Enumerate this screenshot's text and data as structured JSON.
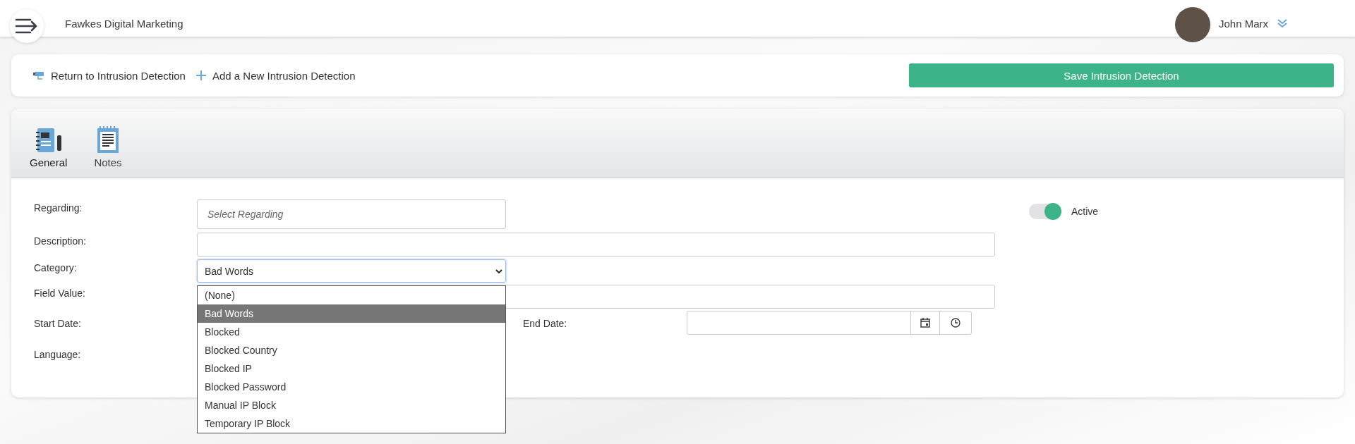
{
  "header": {
    "company": "Fawkes Digital Marketing",
    "user": "John Marx"
  },
  "toolbar": {
    "links": [
      "Return to Intrusion Detection",
      "Add a New Intrusion Detection"
    ],
    "save_button": "Save Intrusion Detection"
  },
  "tabs": [
    {
      "label": "General",
      "selected": true
    },
    {
      "label": "Notes",
      "selected": false
    }
  ],
  "form": {
    "regarding": {
      "label": "Regarding:",
      "placeholder": "Select Regarding"
    },
    "description": {
      "label": "Description:"
    },
    "category": {
      "label": "Category:",
      "value": "Bad Words",
      "expanded": true,
      "options": [
        {
          "label": "(None)",
          "selected": false
        },
        {
          "label": "Bad Words",
          "selected": true
        },
        {
          "label": "Blocked",
          "selected": false
        },
        {
          "label": "Blocked Country",
          "selected": false
        },
        {
          "label": "Blocked IP",
          "selected": false
        },
        {
          "label": "Blocked Password",
          "selected": false
        },
        {
          "label": "Manual IP Block",
          "selected": false
        },
        {
          "label": "Temporary IP Block",
          "selected": false
        }
      ]
    },
    "field_value": {
      "label": "Field Value:"
    },
    "start_date": {
      "label": "Start Date:"
    },
    "end_date": {
      "label": "End Date:"
    },
    "language": {
      "label": "Language:"
    },
    "active": {
      "label": "Active",
      "on": true
    }
  }
}
